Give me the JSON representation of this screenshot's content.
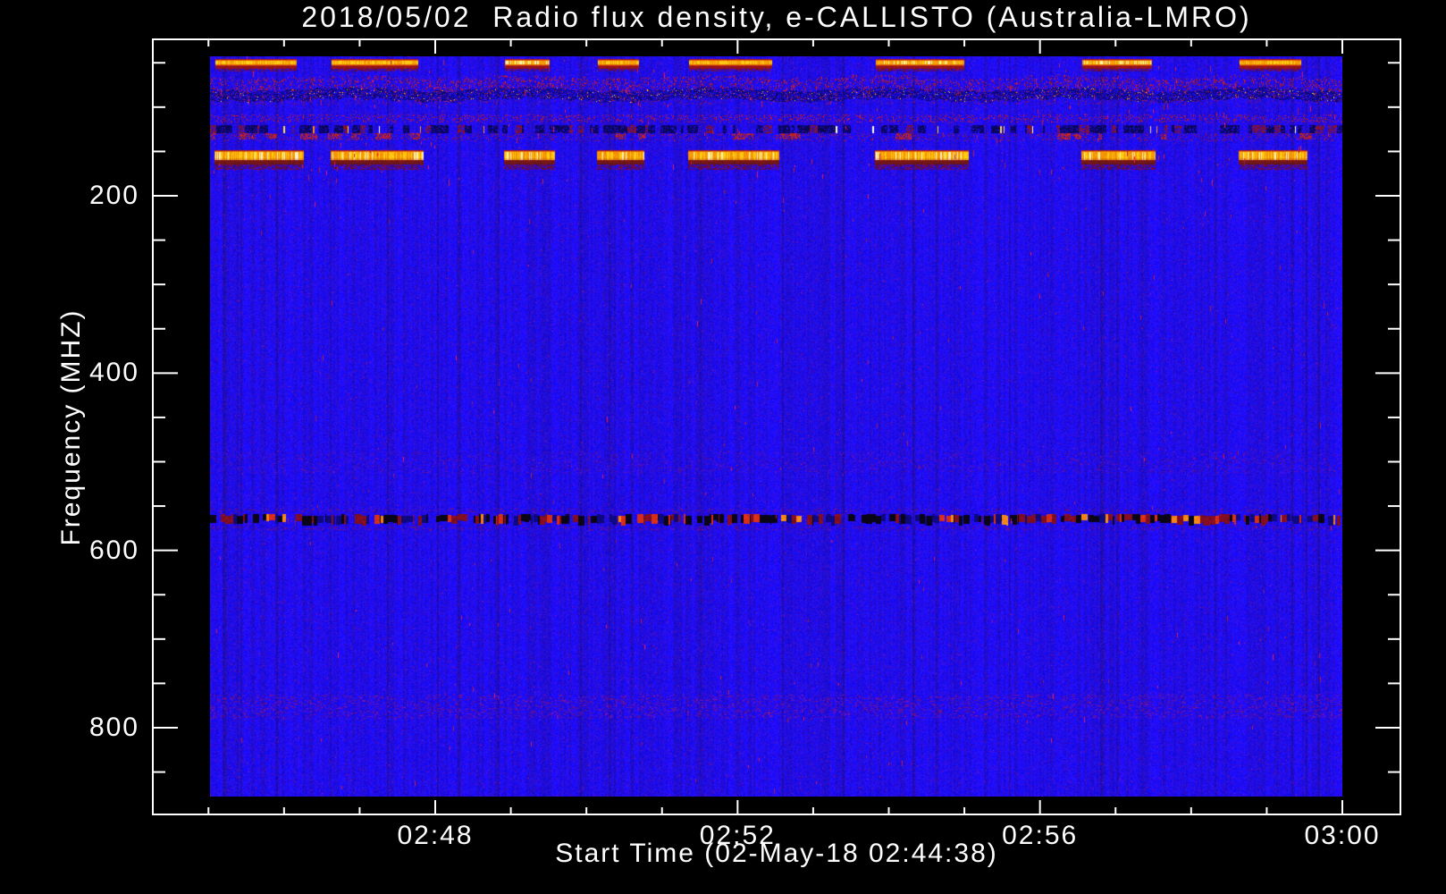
{
  "window": {
    "background_color": "#000000",
    "foreground_color": "#ffffff"
  },
  "chart_data": {
    "type": "heatmap",
    "title": "2018/05/02  Radio flux density, e-CALLISTO (Australia-LMRO)",
    "xlabel": "Start Time (02-May-18 02:44:38)",
    "ylabel": "Frequency (MHZ)",
    "x_tick_labels": [
      "02:48",
      "02:52",
      "02:56",
      "03:00"
    ],
    "x_minor_tick_interval": "1 minute",
    "x_start_time": "02:44:38",
    "x_end_time": "03:00",
    "y_tick_labels": [
      "200",
      "400",
      "600",
      "800"
    ],
    "y_minor_step_mhz": 50,
    "y_axis_increases_downward": true,
    "image_freq_span_mhz": [
      43,
      878
    ],
    "legend": "none",
    "grid": "off",
    "colormap": "quiet blue continuum; interference appears red/orange/yellow/white",
    "palette": {
      "quiet_background": "#2010ee",
      "dark_fleck": "#3c14be",
      "burst_core_yellow": "#ffc828",
      "burst_bright_white": "#fff4b4",
      "burst_edge_dark_red": "#8c1016",
      "speckle_red": "#c83c28",
      "dark_lane_navy": "#0a0666",
      "dot_white": "#ffffff"
    },
    "bands": [
      {
        "label": "strong intermittent bursts (dashed, brightest)",
        "freq_range_mhz": [
          46,
          60
        ],
        "pattern": "bright yellow/orange dashes with dark-red lower edge, ~50% duty cycle"
      },
      {
        "label": "broadband speckle with dark lane",
        "freq_range_mhz": [
          66,
          96
        ],
        "pattern": "dense red speckle over blue, wavy dark navy lane near 90 MHz with red dashes"
      },
      {
        "label": "dotted interference line",
        "freq_range_mhz": [
          119,
          131
        ],
        "pattern": "dark dashed lane peppered with bright white/yellow/red dots"
      },
      {
        "label": "strong intermittent bursts (dashed, thick)",
        "freq_range_mhz": [
          149,
          177
        ],
        "pattern": "bright orange/yellow dashes aligned with the 46-60 MHz bursts, dark-red skirt"
      },
      {
        "label": "faint mottled band",
        "freq_range_mhz": [
          488,
          512
        ],
        "pattern": "very faint purple-red mottling"
      },
      {
        "label": "dark dashed interference line",
        "freq_range_mhz": [
          557,
          572
        ],
        "pattern": "fine black/dark-red/bright-red dashes across full width"
      },
      {
        "label": "faint mottled band",
        "freq_range_mhz": [
          763,
          789
        ],
        "pattern": "faint purple-red mottling"
      }
    ],
    "background_texture": "fine vertical striping noise of darker purple flecks on bright blue, sparse lone red streaks"
  }
}
